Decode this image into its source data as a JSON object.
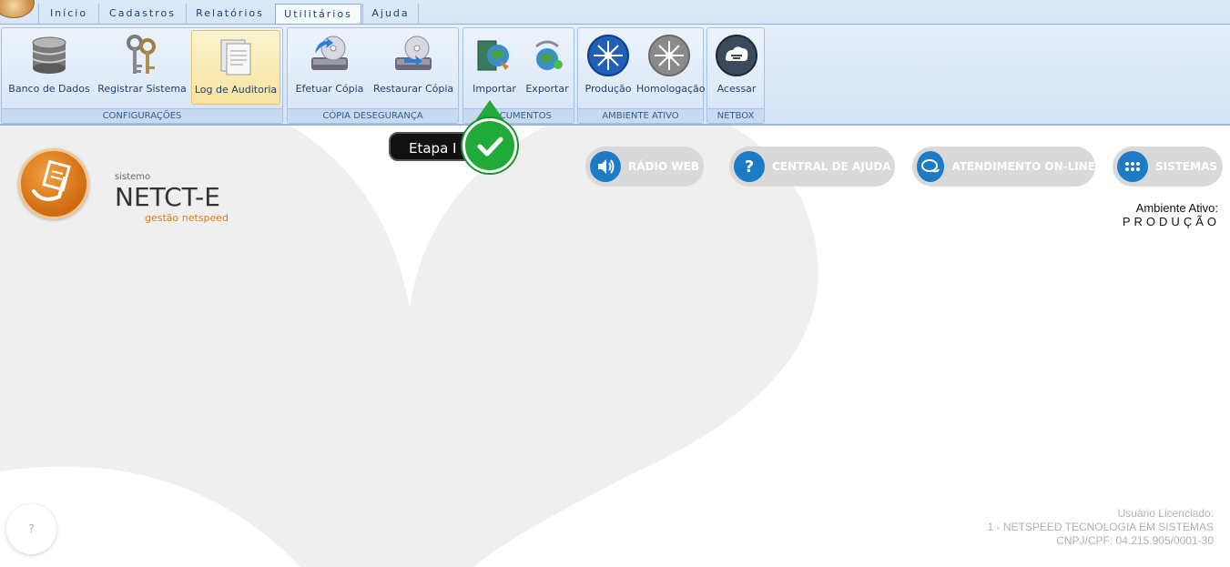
{
  "tabs": [
    {
      "label": "Início"
    },
    {
      "label": "Cadastros"
    },
    {
      "label": "Relatórios"
    },
    {
      "label": "Utilitários"
    },
    {
      "label": "Ajuda"
    }
  ],
  "active_tab": "Utilitários",
  "groups": {
    "configuracoes": {
      "label": "CONFIGURAÇÕES",
      "buttons": [
        "Banco de Dados",
        "Registrar Sistema",
        "Log de Auditoria"
      ]
    },
    "copia": {
      "label": "CÓPIA DESEGURANÇA",
      "buttons": [
        "Efetuar Cópia",
        "Restaurar Cópia"
      ]
    },
    "documentos": {
      "label": "DOCUMENTOS",
      "buttons": [
        "Importar",
        "Exportar"
      ]
    },
    "ambiente": {
      "label": "AMBIENTE ATIVO",
      "buttons": [
        "Produção",
        "Homologação"
      ]
    },
    "netbox": {
      "label": "NETBOX",
      "buttons": [
        "Acessar"
      ]
    }
  },
  "logo": {
    "small": "sistemo",
    "name": "NETCT-E",
    "sub": "gestão netspeed"
  },
  "pills": [
    "RÁDIO WEB",
    "CENTRAL DE AJUDA",
    "ATENDIMENTO ON-LINE",
    "SISTEMAS"
  ],
  "ambiente": {
    "label": "Ambiente Ativo:",
    "value": "PRODUÇÃO"
  },
  "tooltip": {
    "text": "Etapa I"
  },
  "help_glyph": "?",
  "license": {
    "line1": "Usuário Licenciado:",
    "line2": "1 - NETSPEED TECNOLOGIA EM SISTEMAS",
    "line3": "CNPJ/CPF: 04.215.905/0001-30"
  },
  "colors": {
    "accent_blue": "#1d7bc5",
    "logo_orange": "#d06a10",
    "check_green": "#1faa3a"
  },
  "icons": {
    "banco": "database-icon",
    "registrar": "keys-icon",
    "log": "document-icon",
    "efetuar": "disk-backup-icon",
    "restaurar": "disk-restore-icon",
    "importar": "import-globe-icon",
    "exportar": "export-globe-icon",
    "producao": "producao-burst-icon",
    "homologacao": "homologacao-burst-icon",
    "acessar": "netbox-cloud-icon",
    "radio": "speaker-icon",
    "ajuda": "question-icon",
    "atendimento": "chat-icon",
    "sistemas": "grid-icon",
    "check": "check-icon"
  }
}
